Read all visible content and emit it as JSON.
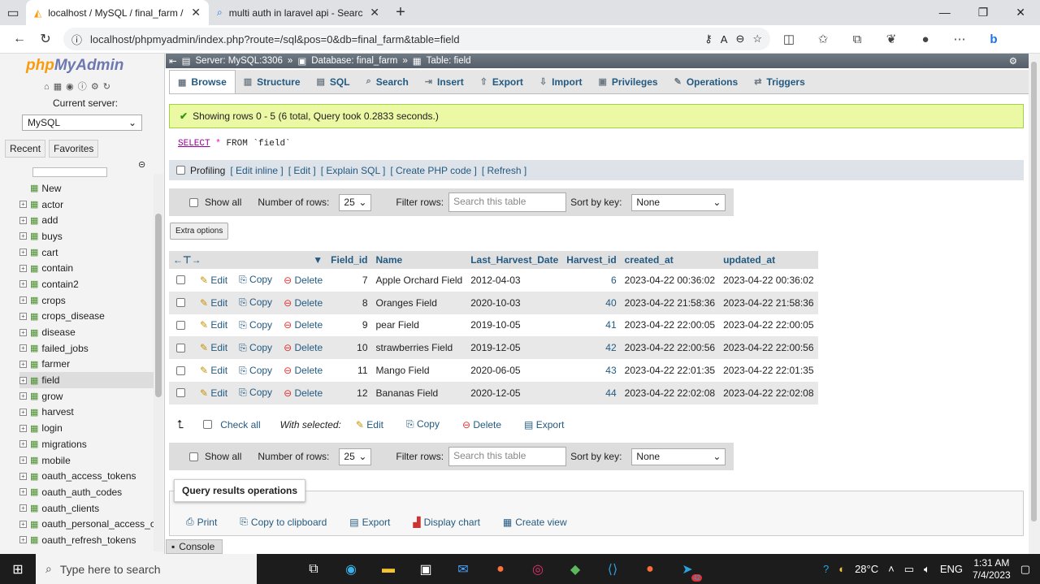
{
  "browser": {
    "tabs": [
      {
        "title": "localhost / MySQL / final_farm / f"
      },
      {
        "title": "multi auth in laravel api - Search"
      }
    ],
    "url": "localhost/phpmyadmin/index.php?route=/sql&pos=0&db=final_farm&table=field"
  },
  "sidebar": {
    "logo_php": "php",
    "logo_my": "MyAdmin",
    "current_server_label": "Current server:",
    "server": "MySQL",
    "recent": "Recent",
    "favorites": "Favorites",
    "tables": [
      "New",
      "actor",
      "add",
      "buys",
      "cart",
      "contain",
      "contain2",
      "crops",
      "crops_disease",
      "disease",
      "failed_jobs",
      "farmer",
      "field",
      "grow",
      "harvest",
      "login",
      "migrations",
      "mobile",
      "oauth_access_tokens",
      "oauth_auth_codes",
      "oauth_clients",
      "oauth_personal_access_cl",
      "oauth_refresh_tokens"
    ],
    "selected": "field"
  },
  "breadcrumb": {
    "server": "Server: MySQL:3306",
    "database": "Database: final_farm",
    "table": "Table: field"
  },
  "menu": [
    "Browse",
    "Structure",
    "SQL",
    "Search",
    "Insert",
    "Export",
    "Import",
    "Privileges",
    "Operations",
    "Triggers"
  ],
  "success": "Showing rows 0 - 5 (6 total, Query took 0.2833 seconds.)",
  "sql": {
    "select": "SELECT",
    "star": "*",
    "from": "FROM",
    "table": "`field`"
  },
  "profiling": {
    "label": "Profiling",
    "links": [
      "[ Edit inline ]",
      "[ Edit ]",
      "[ Explain SQL ]",
      "[ Create PHP code ]",
      "[ Refresh ]"
    ]
  },
  "nav": {
    "show_all": "Show all",
    "rows_label": "Number of rows:",
    "rows": "25",
    "filter_label": "Filter rows:",
    "filter_placeholder": "Search this table",
    "sort_label": "Sort by key:",
    "sort": "None"
  },
  "extra_options": "Extra options",
  "table": {
    "columns": [
      "Field_id",
      "Name",
      "Last_Harvest_Date",
      "Harvest_id",
      "created_at",
      "updated_at"
    ],
    "actions": {
      "edit": "Edit",
      "copy": "Copy",
      "delete": "Delete"
    },
    "rows": [
      [
        "7",
        "Apple Orchard Field",
        "2012-04-03",
        "6",
        "2023-04-22 00:36:02",
        "2023-04-22 00:36:02"
      ],
      [
        "8",
        "Oranges  Field",
        "2020-10-03",
        "40",
        "2023-04-22 21:58:36",
        "2023-04-22 21:58:36"
      ],
      [
        "9",
        "pear Field",
        "2019-10-05",
        "41",
        "2023-04-22 22:00:05",
        "2023-04-22 22:00:05"
      ],
      [
        "10",
        "strawberries Field",
        "2019-12-05",
        "42",
        "2023-04-22 22:00:56",
        "2023-04-22 22:00:56"
      ],
      [
        "11",
        "Mango Field",
        "2020-06-05",
        "43",
        "2023-04-22 22:01:35",
        "2023-04-22 22:01:35"
      ],
      [
        "12",
        "Bananas Field",
        "2020-12-05",
        "44",
        "2023-04-22 22:02:08",
        "2023-04-22 22:02:08"
      ]
    ]
  },
  "with_selected": {
    "check_all": "Check all",
    "label": "With selected:",
    "edit": "Edit",
    "copy": "Copy",
    "delete": "Delete",
    "export": "Export"
  },
  "qro": {
    "title": "Query results operations",
    "items": [
      "Print",
      "Copy to clipboard",
      "Export",
      "Display chart",
      "Create view"
    ]
  },
  "console": "Console",
  "taskbar": {
    "search": "Type here to search",
    "temp": "28°C",
    "lang": "ENG",
    "time": "1:31 AM",
    "date": "7/4/2023",
    "badge": "42"
  }
}
